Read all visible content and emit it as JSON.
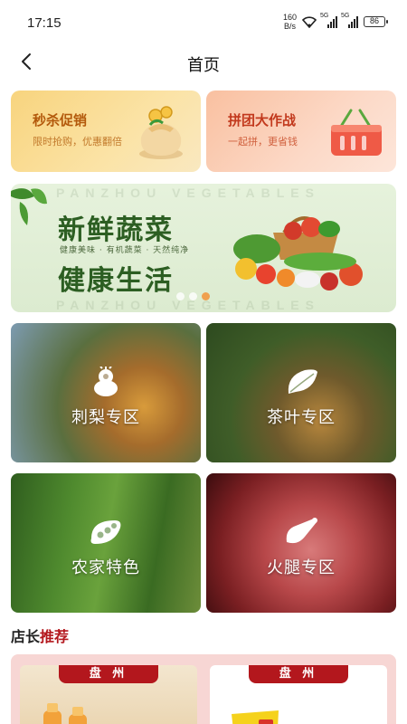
{
  "status_bar": {
    "time": "17:15",
    "net_speed_value": "160",
    "net_speed_unit": "B/s",
    "sim1": "5G",
    "sim2": "5G",
    "battery": "86"
  },
  "header": {
    "back_icon": "chevron-left-icon",
    "title": "首页"
  },
  "promos": [
    {
      "title": "秒杀促销",
      "subtitle": "限时抢购，优惠翻倍"
    },
    {
      "title": "拼团大作战",
      "subtitle": "一起拼，更省钱"
    }
  ],
  "banner": {
    "watermark": "PANZHOU VEGETABLES",
    "headline1": "新鲜蔬菜",
    "tagline": "健康美味 · 有机蔬菜 · 天然纯净",
    "headline2": "健康生活",
    "active_slide": 3,
    "slide_count": 3
  },
  "categories": [
    {
      "label": "刺梨专区",
      "icon": "pear-icon"
    },
    {
      "label": "茶叶专区",
      "icon": "tea-leaf-icon"
    },
    {
      "label": "农家特色",
      "icon": "pea-pod-icon"
    },
    {
      "label": "火腿专区",
      "icon": "ham-icon"
    }
  ],
  "section": {
    "title_prefix": "店长",
    "title_accent": "推荐",
    "accent_color": "#b3171d"
  },
  "recommend": [
    {
      "ribbon": "盘 州"
    },
    {
      "ribbon": "盘 州"
    }
  ]
}
